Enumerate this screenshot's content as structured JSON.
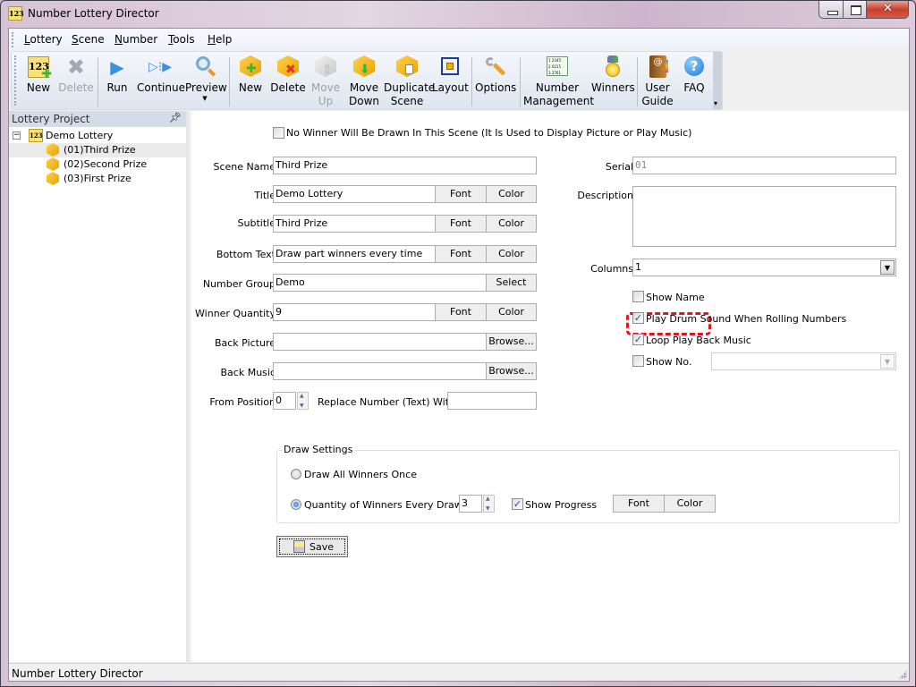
{
  "window": {
    "title": "Number Lottery Director",
    "app_icon": "123-icon"
  },
  "menu": {
    "items": [
      {
        "label": "Lottery",
        "accel": "L"
      },
      {
        "label": "Scene",
        "accel": "S"
      },
      {
        "label": "Number",
        "accel": "N"
      },
      {
        "label": "Tools",
        "accel": "T"
      },
      {
        "label": "Help",
        "accel": "H"
      }
    ]
  },
  "toolbar": {
    "buttons": [
      {
        "id": "new-lottery",
        "label": "New",
        "icon": "new-lottery-icon",
        "enabled": true
      },
      {
        "id": "delete-lottery",
        "label": "Delete",
        "icon": "delete-x-icon",
        "enabled": false
      },
      {
        "id": "run",
        "label": "Run",
        "icon": "play-triangle-icon",
        "enabled": true
      },
      {
        "id": "continue",
        "label": "Continue",
        "icon": "continue-arrow-icon",
        "enabled": true
      },
      {
        "id": "preview",
        "label": "Preview",
        "icon": "magnifier-icon",
        "enabled": true,
        "dropdown": true
      },
      {
        "id": "new-scene",
        "label": "New",
        "icon": "cube-plus-icon",
        "enabled": true
      },
      {
        "id": "delete-scene",
        "label": "Delete",
        "icon": "cube-x-icon",
        "enabled": true
      },
      {
        "id": "move-up",
        "label": "Move Up",
        "line1": "Move",
        "line2": "Up",
        "icon": "cube-up-icon",
        "enabled": false
      },
      {
        "id": "move-down",
        "label": "Move Down",
        "line1": "Move",
        "line2": "Down",
        "icon": "cube-down-icon",
        "enabled": true
      },
      {
        "id": "duplicate-scene",
        "label": "Duplicate Scene",
        "line1": "Duplicate",
        "line2": "Scene",
        "icon": "cube-copy-icon",
        "enabled": true
      },
      {
        "id": "layout",
        "label": "Layout",
        "icon": "layout-frame-icon",
        "enabled": true
      },
      {
        "id": "options",
        "label": "Options",
        "icon": "wrench-icon",
        "enabled": true
      },
      {
        "id": "number-management",
        "label": "Number Management",
        "line1": "Number",
        "line2": "Management",
        "icon": "number-table-icon",
        "enabled": true
      },
      {
        "id": "winners",
        "label": "Winners",
        "icon": "medal-icon",
        "enabled": true
      },
      {
        "id": "user-guide",
        "label": "User Guide",
        "line1": "User",
        "line2": "Guide",
        "icon": "address-book-icon",
        "enabled": true
      },
      {
        "id": "faq",
        "label": "FAQ",
        "icon": "help-question-icon",
        "enabled": true
      }
    ],
    "number_icon_rows": [
      "1 2345",
      "2 0215",
      "3 2761"
    ]
  },
  "left_panel": {
    "title": "Lottery Project",
    "tree": {
      "root": {
        "label": "Demo Lottery",
        "expanded": true
      },
      "children": [
        {
          "label": "(01)Third Prize",
          "selected": true
        },
        {
          "label": "(02)Second Prize",
          "selected": false
        },
        {
          "label": "(03)First Prize",
          "selected": false
        }
      ]
    }
  },
  "form": {
    "no_winner": {
      "label": "No Winner Will Be Drawn In This Scene   (It Is Used to Display Picture or Play Music)",
      "checked": false
    },
    "scene_name": {
      "label": "Scene Name",
      "value": "Third Prize"
    },
    "title": {
      "label": "Title",
      "value": "Demo Lottery"
    },
    "subtitle": {
      "label": "Subtitle",
      "value": "Third Prize"
    },
    "bottom_text": {
      "label": "Bottom Text",
      "value": "Draw part winners every time"
    },
    "number_group": {
      "label": "Number Group",
      "value": "Demo"
    },
    "winner_quantity": {
      "label": "Winner Quantity",
      "value": "9"
    },
    "back_picture": {
      "label": "Back Picture",
      "value": ""
    },
    "back_music": {
      "label": "Back Music",
      "value": ""
    },
    "from_position": {
      "label": "From Position",
      "value": "0"
    },
    "replace_number": {
      "label": "Replace Number (Text) With",
      "value": ""
    },
    "serial": {
      "label": "Serial",
      "value": "01"
    },
    "description": {
      "label": "Description",
      "value": ""
    },
    "columns": {
      "label": "Columns",
      "value": "1"
    },
    "show_name": {
      "label": "Show Name",
      "checked": false,
      "highlighted": true
    },
    "play_drum": {
      "label": "Play Drum Sound When Rolling Numbers",
      "checked": true
    },
    "loop_music": {
      "label": "Loop Play Back Music",
      "checked": true
    },
    "show_no": {
      "label": "Show No.",
      "checked": false,
      "value": ""
    },
    "buttons": {
      "font": "Font",
      "color": "Color",
      "select": "Select",
      "browse": "Browse..."
    },
    "draw_settings": {
      "title": "Draw Settings",
      "all_once": {
        "label": "Draw All Winners Once",
        "selected": false
      },
      "per_draw": {
        "label": "Quantity of Winners Every Draw",
        "selected": true,
        "value": "3"
      },
      "show_progress": {
        "label": "Show Progress",
        "checked": true
      }
    },
    "save": "Save"
  },
  "status": {
    "text": "Number Lottery Director"
  },
  "colors": {
    "highlight": "#e8121e",
    "accent_checkmark": "#2a4a9a"
  }
}
